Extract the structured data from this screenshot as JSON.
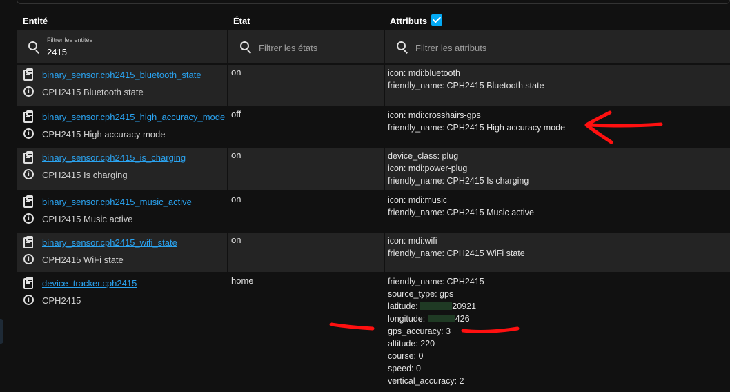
{
  "headers": {
    "entity": "Entité",
    "state": "État",
    "attributes": "Attributs"
  },
  "filters": {
    "entity_label": "Filtrer les entités",
    "entity_value": "2415",
    "state_placeholder": "Filtrer les états",
    "attr_placeholder": "Filtrer les attributs"
  },
  "rows": [
    {
      "entity_id": "binary_sensor.cph2415_bluetooth_state",
      "name": "CPH2415 Bluetooth state",
      "state": "on",
      "attributes": [
        "icon: mdi:bluetooth",
        "friendly_name: CPH2415 Bluetooth state"
      ]
    },
    {
      "entity_id": "binary_sensor.cph2415_high_accuracy_mode",
      "name": "CPH2415 High accuracy mode",
      "state": "off",
      "attributes": [
        "icon: mdi:crosshairs-gps",
        "friendly_name: CPH2415 High accuracy mode"
      ]
    },
    {
      "entity_id": "binary_sensor.cph2415_is_charging",
      "name": "CPH2415 Is charging",
      "state": "on",
      "attributes": [
        "device_class: plug",
        "icon: mdi:power-plug",
        "friendly_name: CPH2415 Is charging"
      ]
    },
    {
      "entity_id": "binary_sensor.cph2415_music_active",
      "name": "CPH2415 Music active",
      "state": "on",
      "attributes": [
        "icon: mdi:music",
        "friendly_name: CPH2415 Music active"
      ]
    },
    {
      "entity_id": "binary_sensor.cph2415_wifi_state",
      "name": "CPH2415 WiFi state",
      "state": "on",
      "attributes": [
        "icon: mdi:wifi",
        "friendly_name: CPH2415 WiFi state"
      ]
    },
    {
      "entity_id": "device_tracker.cph2415",
      "name": "CPH2415",
      "state": "home",
      "attributes": [
        "friendly_name: CPH2415",
        "source_type: gps"
      ],
      "latitude_label": "latitude:",
      "latitude_tail": "20921",
      "longitude_label": "longitude:",
      "longitude_tail": "426",
      "attributes_after": [
        "gps_accuracy: 3",
        "altitude: 220",
        "course: 0",
        "speed: 0",
        "vertical_accuracy: 2"
      ]
    }
  ],
  "colors": {
    "link": "#2aa3f0",
    "checkbox": "#03a9f4",
    "annotation": "#ff0000"
  }
}
